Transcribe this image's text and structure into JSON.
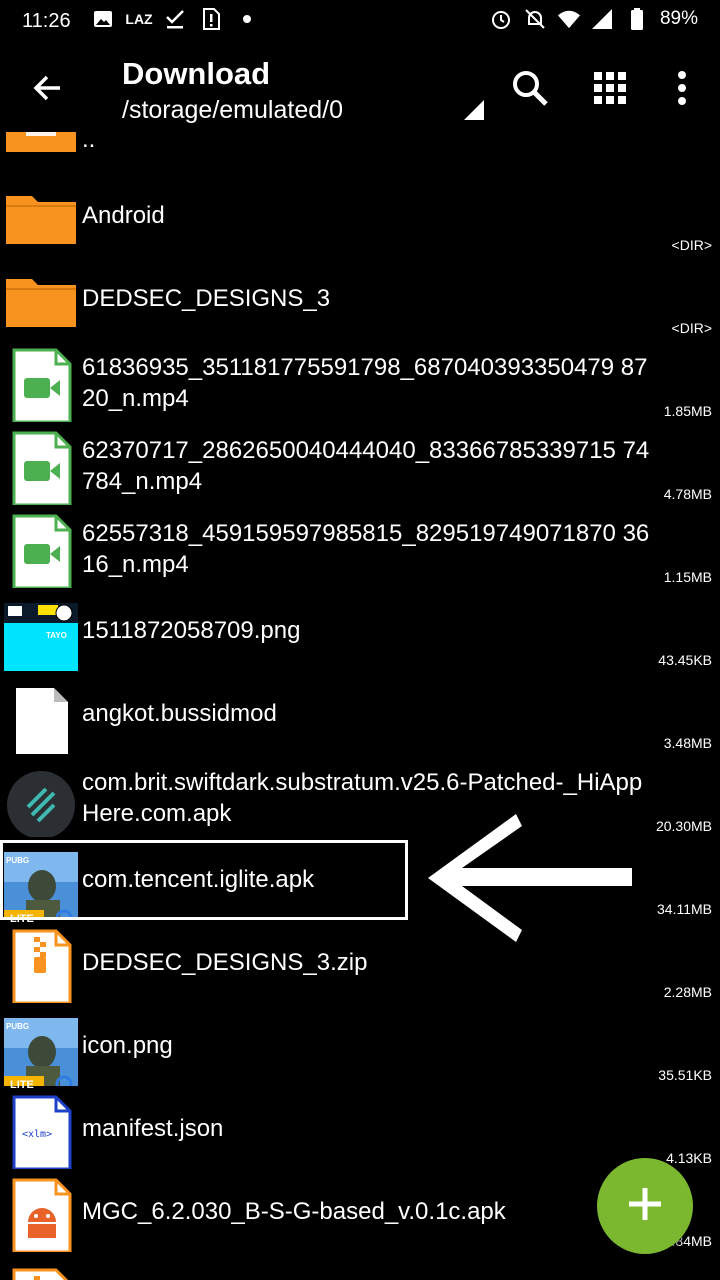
{
  "status_bar": {
    "time": "11:26",
    "left_icons": [
      "image-icon",
      "laz-icon",
      "checkmark-download-icon",
      "sim-alert-icon",
      "dot-icon"
    ],
    "right_icons": [
      "alarm-icon",
      "bell-off-icon",
      "wifi-icon",
      "signal-icon",
      "battery-icon"
    ],
    "battery": "89%",
    "laz_label": "LAZ"
  },
  "app_bar": {
    "title": "Download",
    "path": "/storage/emulated/0",
    "icons": [
      "back-arrow-icon",
      "search-icon",
      "grid-view-icon",
      "more-vert-icon"
    ]
  },
  "files": [
    {
      "name": "..",
      "meta": "",
      "icon": "folder-up-icon"
    },
    {
      "name": "Android",
      "meta": "<DIR>",
      "icon": "folder-icon"
    },
    {
      "name": "DEDSEC_DESIGNS_3",
      "meta": "<DIR>",
      "icon": "folder-icon"
    },
    {
      "name": "61836935_351181775591798_687040393350479 8720_n.mp4",
      "meta": "1.85MB",
      "icon": "video-file-icon"
    },
    {
      "name": "62370717_2862650040444040_83366785339715 74784_n.mp4",
      "meta": "4.78MB",
      "icon": "video-file-icon"
    },
    {
      "name": "62557318_459159597985815_829519749071870 3616_n.mp4",
      "meta": "1.15MB",
      "icon": "video-file-icon"
    },
    {
      "name": "1511872058709.png",
      "meta": "43.45KB",
      "icon": "image-thumbnail-icon"
    },
    {
      "name": "angkot.bussidmod",
      "meta": "3.48MB",
      "icon": "blank-file-icon"
    },
    {
      "name": "com.brit.swiftdark.substratum.v25.6-Patched-_HiAppHere.com.apk",
      "meta": "20.30MB",
      "icon": "app-apk-icon"
    },
    {
      "name": "com.tencent.iglite.apk",
      "meta": "34.11MB",
      "icon": "pubg-lite-icon"
    },
    {
      "name": "DEDSEC_DESIGNS_3.zip",
      "meta": "2.28MB",
      "icon": "zip-file-icon"
    },
    {
      "name": "icon.png",
      "meta": "35.51KB",
      "icon": "pubg-lite-icon"
    },
    {
      "name": "manifest.json",
      "meta": "4.13KB",
      "icon": "xml-file-icon"
    },
    {
      "name": "MGC_6.2.030_B-S-G-based_v.0.1c.apk",
      "meta": "65.84MB",
      "icon": "android-apk-icon"
    }
  ],
  "thumb_texts": {
    "pubg": "PUBG",
    "lite": "LITE",
    "xml": "<xlm>",
    "tayo": "TAYO"
  },
  "fab": {
    "icon": "add-icon"
  },
  "colors": {
    "background": "#000000",
    "folder": "#f7931e",
    "video": "#4caf50",
    "fab": "#7cb82f",
    "xml": "#1e40c8"
  }
}
